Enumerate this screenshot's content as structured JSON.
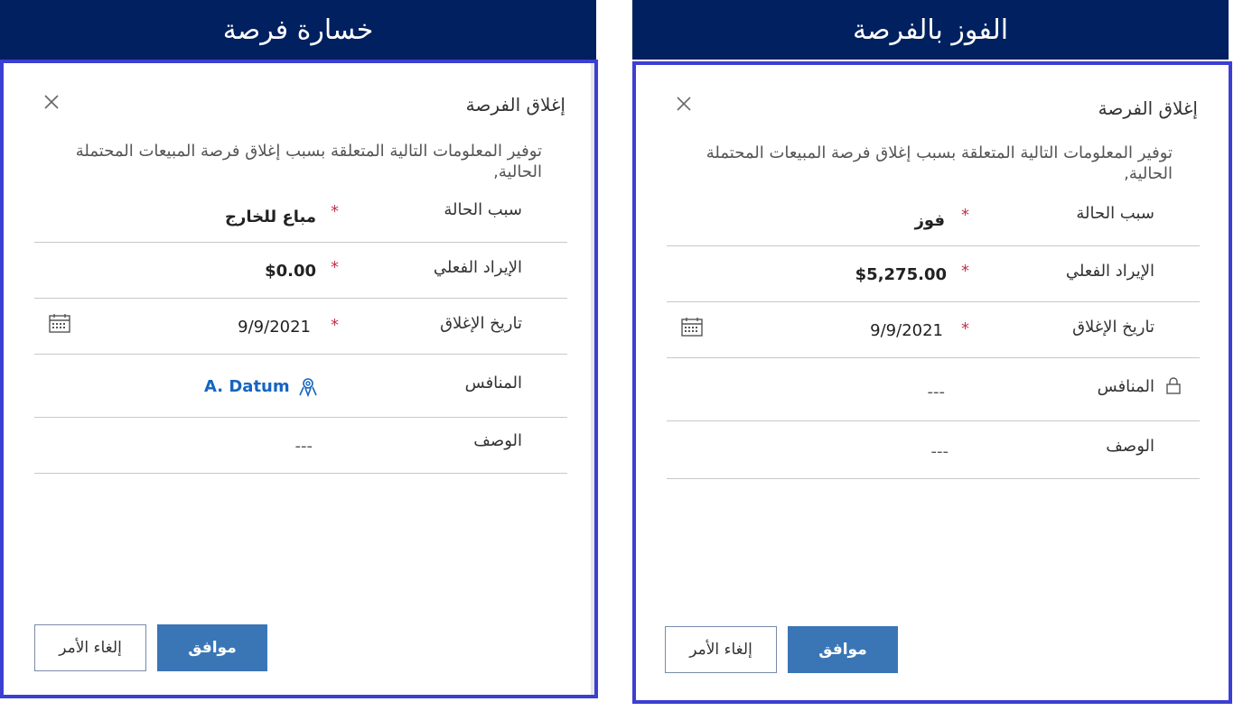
{
  "panels": [
    {
      "banner": "خسارة فرصة",
      "dialog_title": "إغلاق الفرصة",
      "description": "توفير المعلومات التالية المتعلقة بسبب إغلاق فرصة المبيعات المحتملة الحالية,",
      "fields": {
        "status_reason": {
          "label": "سبب الحالة",
          "value": "مباع للخارج"
        },
        "actual_revenue": {
          "label": "الإيراد الفعلي",
          "value": "$0.00"
        },
        "close_date": {
          "label": "تاريخ الإغلاق",
          "value": "9/9/2021"
        },
        "competitor": {
          "label": "المنافس",
          "value": "A. Datum"
        },
        "description": {
          "label": "الوصف",
          "value": "---"
        }
      },
      "ok_label": "موافق",
      "cancel_label": "إلغاء الأمر"
    },
    {
      "banner": "الفوز بالفرصة",
      "dialog_title": "إغلاق الفرصة",
      "description": "توفير المعلومات التالية المتعلقة بسبب إغلاق فرصة المبيعات المحتملة الحالية,",
      "fields": {
        "status_reason": {
          "label": "سبب الحالة",
          "value": "فوز"
        },
        "actual_revenue": {
          "label": "الإيراد الفعلي",
          "value": "$5,275.00"
        },
        "close_date": {
          "label": "تاريخ الإغلاق",
          "value": "9/9/2021"
        },
        "competitor": {
          "label": "المنافس",
          "value": "---"
        },
        "description": {
          "label": "الوصف",
          "value": "---"
        }
      },
      "ok_label": "موافق",
      "cancel_label": "إلغاء الأمر"
    }
  ],
  "required_marker": "*",
  "colors": {
    "banner": "#002060",
    "dialog_border": "#3c3fd1",
    "ok_button": "#3a76b6",
    "required": "#c4314b",
    "link": "#1565c0"
  },
  "icons": [
    "close-icon",
    "calendar-icon",
    "competitor-icon",
    "lock-icon"
  ]
}
